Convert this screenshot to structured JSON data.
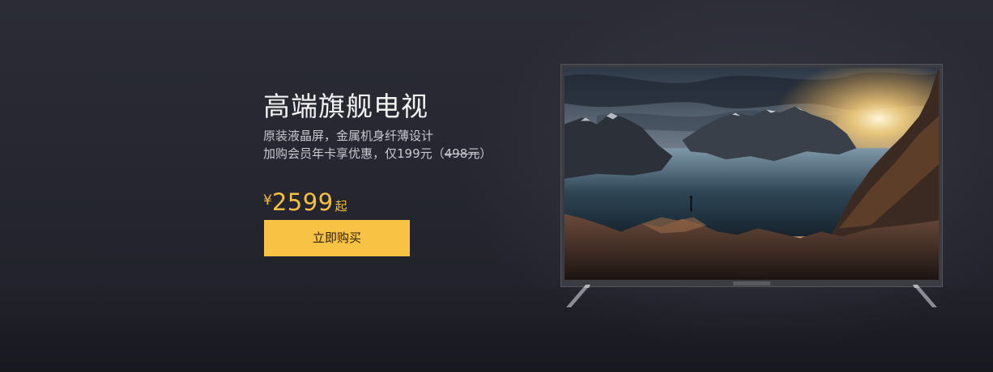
{
  "banner": {
    "title": "高端旗舰电视",
    "subtitle_line1": "原装液晶屏，金属机身纤薄设计",
    "subtitle_line2_prefix": "加购会员年卡享优惠，仅199元（",
    "subtitle_line2_strike": "498元",
    "subtitle_line2_suffix": "）",
    "price": {
      "currency": "¥",
      "amount": "2599",
      "suffix": "起"
    },
    "buy_button_label": "立即购买"
  },
  "colors": {
    "accent": "#f8c245",
    "price": "#f5c042",
    "background": "#25262f"
  },
  "icons": {
    "tv_logo": "mi-logo-icon"
  }
}
